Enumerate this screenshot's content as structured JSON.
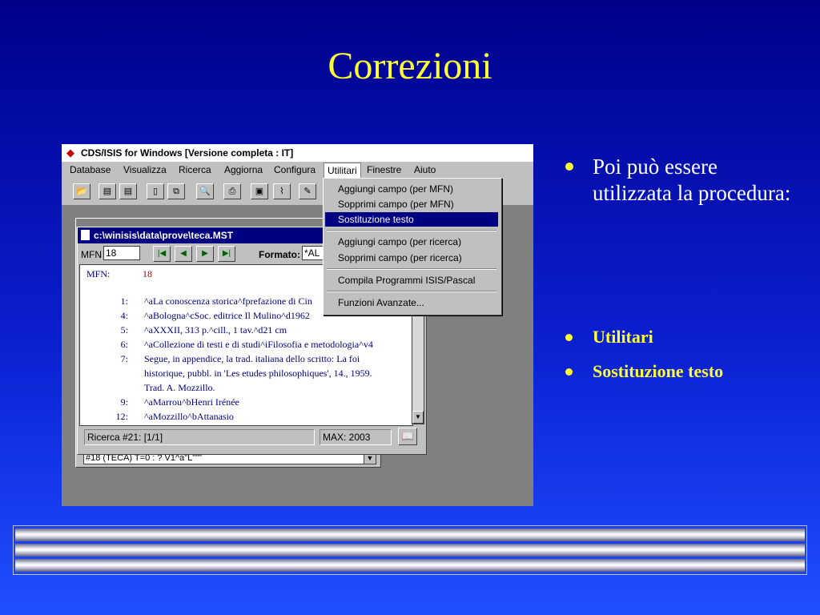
{
  "slide": {
    "title": "Correzioni",
    "bullet_main": "Poi può essere utilizzata la procedura:",
    "sub_bullets": [
      "Utilitari",
      "Sostituzione testo"
    ]
  },
  "app": {
    "title": "CDS/ISIS for Windows [Versione completa : IT]",
    "menu": [
      "Database",
      "Visualizza",
      "Ricerca",
      "Aggiorna",
      "Configura",
      "Utilitari",
      "Finestre",
      "Aiuto"
    ],
    "active_menu": "Utilitari"
  },
  "toolbar": {
    "icons": [
      "open-folder-icon",
      "iso-export-icon",
      "rtf-export-icon",
      "clipboard-icon",
      "copy-icon",
      "print-preview-icon",
      "print-icon",
      "save-icon",
      "broom-icon",
      "edit-icon"
    ]
  },
  "utilitari_menu": {
    "items": [
      "Aggiungi campo (per MFN)",
      "Sopprimi campo (per MFN)",
      "Sostituzione testo",
      "Aggiungi campo (per ricerca)",
      "Sopprimi campo (per ricerca)",
      "Compila Programmi ISIS/Pascal",
      "Funzioni Avanzate..."
    ],
    "selected": "Sostituzione testo"
  },
  "record_window": {
    "title": "c:\\winisis\\data\\prove\\teca.MST",
    "mfn_label": "MFN",
    "mfn_value": "18",
    "formato_label": "Formato:",
    "formato_value": "*AL",
    "record": {
      "mfn_label": "MFN:",
      "mfn_value": "18",
      "rows": [
        {
          "tag": "1:",
          "value": "^aLa conoscenza storica^fprefazione di Cin"
        },
        {
          "tag": "4:",
          "value": "^aBologna^cSoc. editrice Il Mulino^d1962"
        },
        {
          "tag": "5:",
          "value": "^aXXXII, 313 p.^cill., 1 tav.^d21 cm"
        },
        {
          "tag": "6:",
          "value": "^aCollezione di testi e di studi^iFilosofia e metodologia^v4"
        },
        {
          "tag": "7:",
          "value": "Segue, in appendice, la trad. italiana dello scritto: La foi"
        },
        {
          "tag": "",
          "value": "historique, pubbl. in 'Les etudes philosophiques', 14., 1959."
        },
        {
          "tag": "",
          "value": "Trad. A. Mozzillo."
        },
        {
          "tag": "9:",
          "value": "^aMarrou^bHenri Irénée"
        },
        {
          "tag": "12:",
          "value": "^aMozzillo^bAttanasio"
        }
      ]
    },
    "status_left": "Ricerca #21: [1/1]",
    "status_right": "MAX: 2003"
  },
  "command_line": "#18 (TECA) T=0 : ? V1^a\"L\"\"\""
}
